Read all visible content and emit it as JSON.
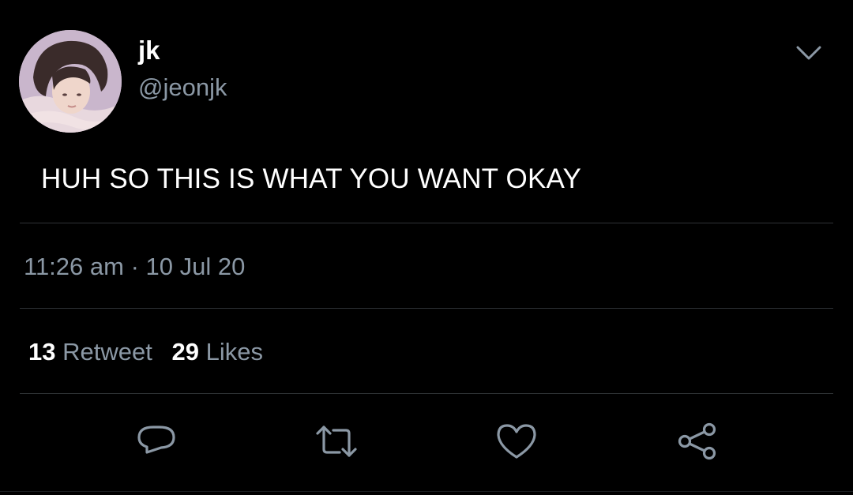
{
  "tweet": {
    "author": {
      "display_name": "jk",
      "handle": "@jeonjk",
      "avatar": "profile-photo"
    },
    "text": "HUH SO THIS IS WHAT YOU WANT OKAY",
    "time": "11:26 am",
    "separator": "·",
    "date": "10 Jul 20",
    "stats": {
      "retweets": {
        "count": "13",
        "label": "Retweet"
      },
      "likes": {
        "count": "29",
        "label": "Likes"
      }
    },
    "actions": [
      {
        "name": "reply",
        "icon": "reply-icon"
      },
      {
        "name": "retweet",
        "icon": "retweet-icon"
      },
      {
        "name": "like",
        "icon": "heart-icon"
      },
      {
        "name": "share",
        "icon": "share-icon"
      }
    ],
    "menu_icon": "chevron-down-icon"
  },
  "colors": {
    "background": "#000000",
    "primary_text": "#ffffff",
    "secondary_text": "#8b98a5",
    "divider": "#2f3336",
    "icon": "#8b98a5"
  }
}
